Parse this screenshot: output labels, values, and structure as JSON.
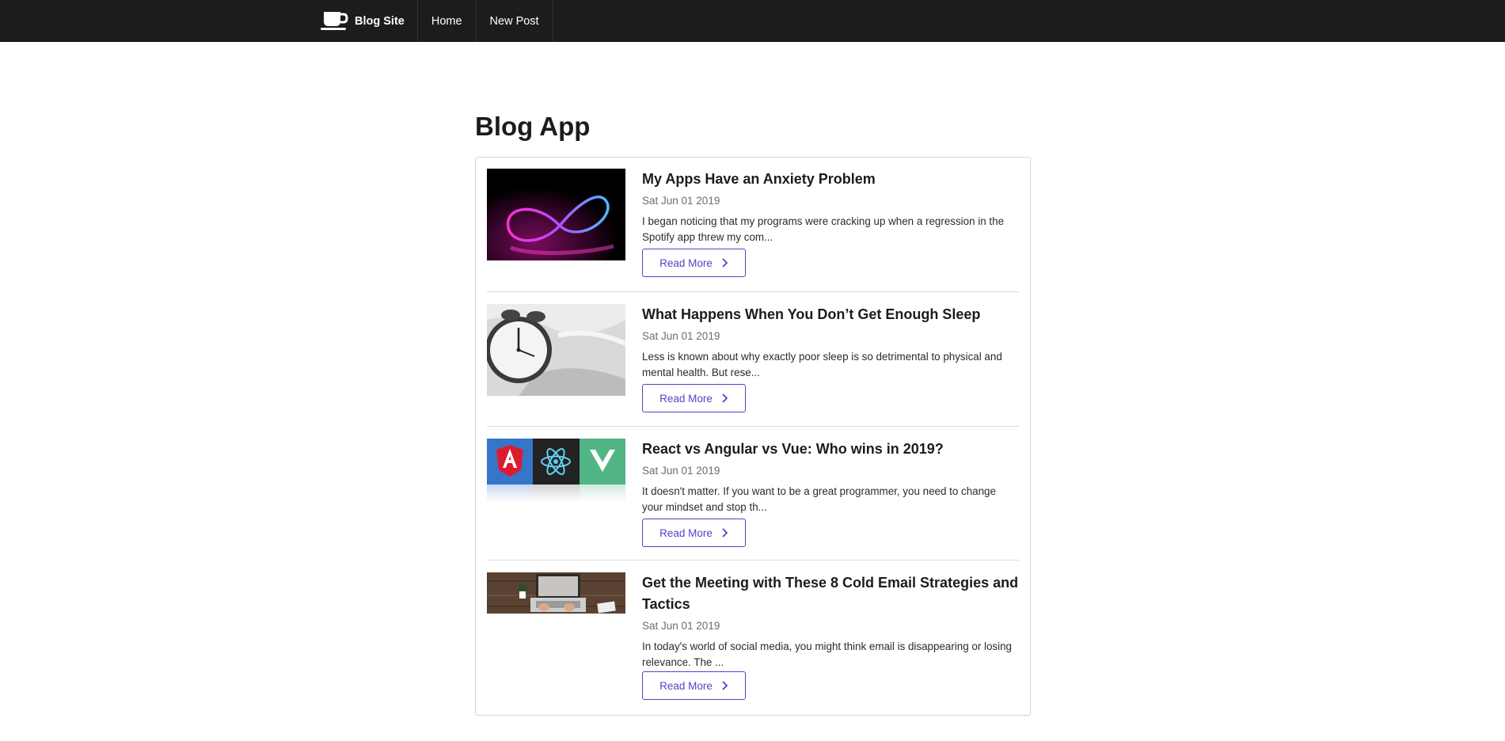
{
  "navbar": {
    "brand_label": "Blog Site",
    "brand_icon": "coffee-cup-icon",
    "links": [
      {
        "label": "Home"
      },
      {
        "label": "New Post"
      }
    ]
  },
  "page_title": "Blog App",
  "read_more_label": "Read More",
  "read_more_icon": "chevron-right-icon",
  "accent_color": "#5b3fc4",
  "posts": [
    {
      "title": "My Apps Have an Anxiety Problem",
      "date": "Sat Jun 01 2019",
      "excerpt": "I began noticing that my programs were cracking up when a regression in the Spotify app threw my com...",
      "image": "neon-light-loop"
    },
    {
      "title": "What Happens When You Don’t Get Enough Sleep",
      "date": "Sat Jun 01 2019",
      "excerpt": "Less is known about why exactly poor sleep is so detrimental to physical and mental health. But rese...",
      "image": "alarm-clock-on-bed"
    },
    {
      "title": "React vs Angular vs Vue: Who wins in 2019?",
      "date": "Sat Jun 01 2019",
      "excerpt": "It doesn't matter. If you want to be a great programmer, you need to change your mindset and stop th...",
      "image": "angular-react-vue-logos"
    },
    {
      "title": "Get the Meeting with These 8 Cold Email Strategies and Tactics",
      "date": "Sat Jun 01 2019",
      "excerpt": "In today's world of social media, you might think email is disappearing or losing relevance. The ...",
      "image": "laptop-on-desk"
    }
  ]
}
